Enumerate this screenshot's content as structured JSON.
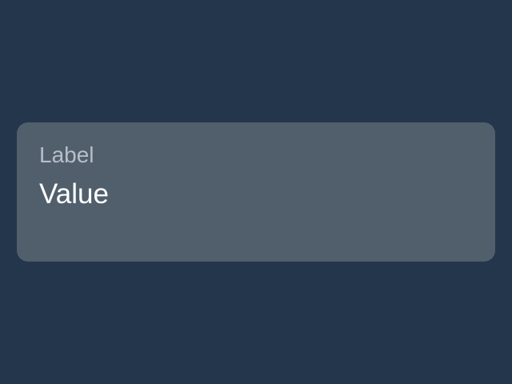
{
  "card": {
    "label": "Label",
    "value": "Value"
  },
  "colors": {
    "background": "#24364b",
    "card_background": "#515f6d",
    "label_text": "#b7bec8",
    "value_text": "#ffffff"
  }
}
